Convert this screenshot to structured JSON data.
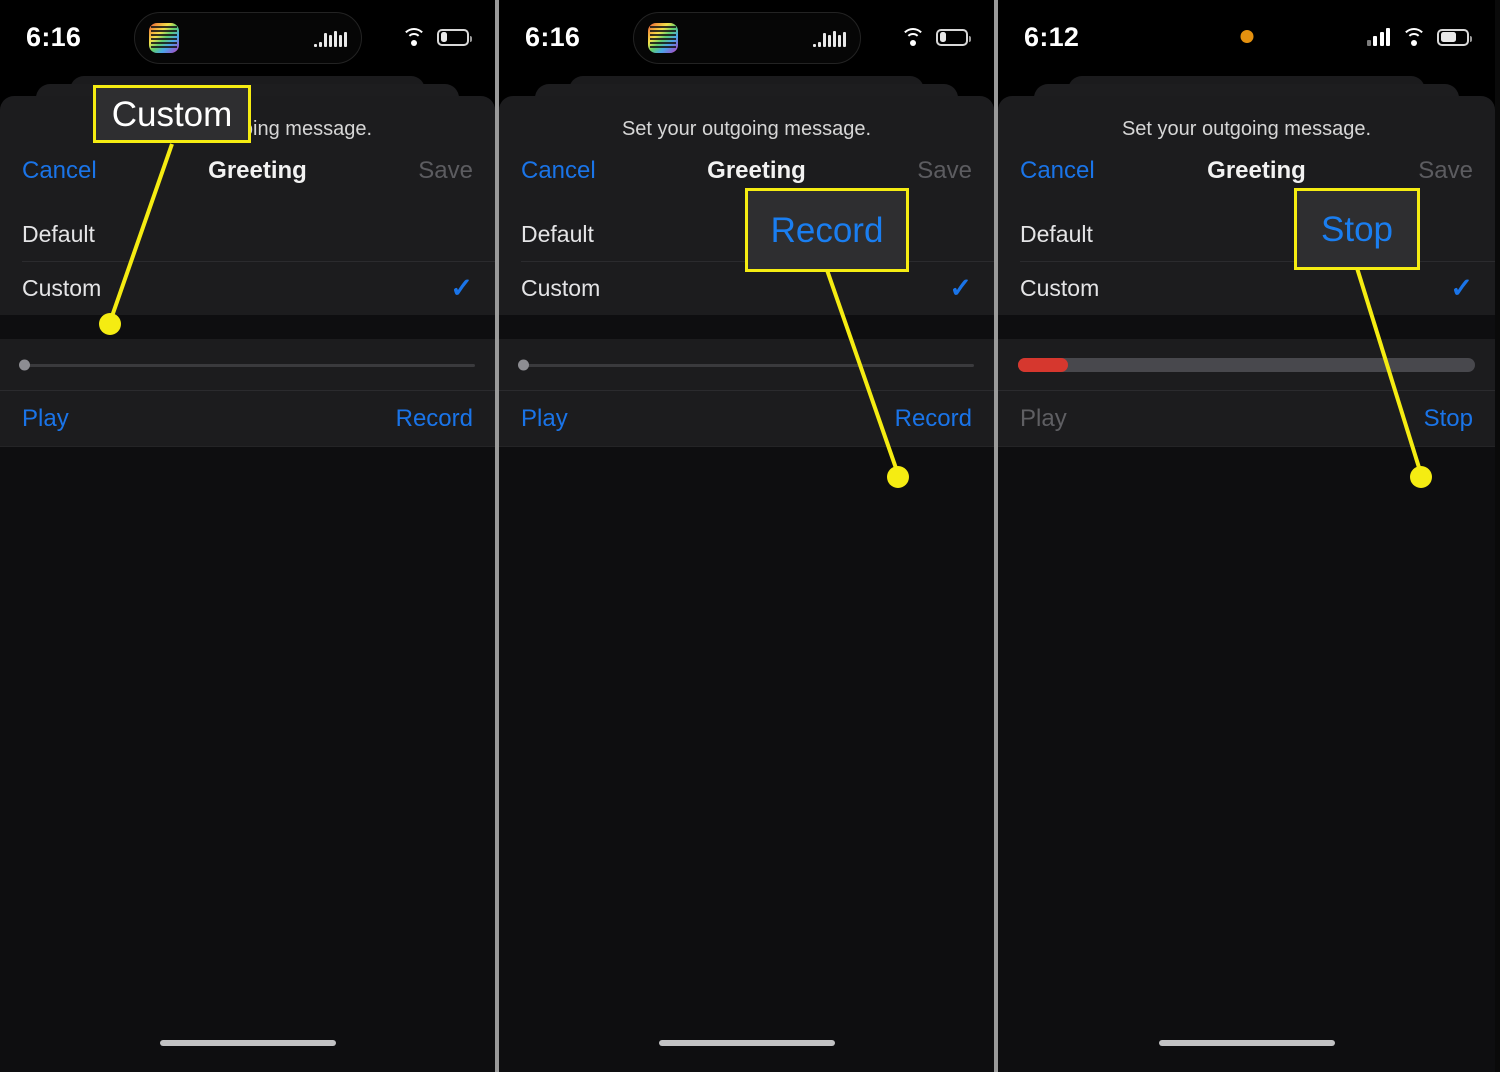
{
  "meta": {
    "accent_blue": "#1a74e8",
    "annotation_yellow": "#f5ec12",
    "record_red": "#d6372e",
    "privacy_orange": "#e5910f",
    "sheet_background": "#1c1c1e"
  },
  "panels": [
    {
      "id": "panel-1",
      "status": {
        "time": "6:16",
        "has_dynamic_island": true,
        "island_icons": [
          "album-art-icon",
          "audio-waveform-icon"
        ],
        "has_privacy_dot": false,
        "has_cellular_signal": false,
        "icons": [
          "wifi-icon",
          "battery-icon"
        ],
        "battery_level_pct": 25
      },
      "sheet": {
        "subtitle": "Set your outgoing message.",
        "cancel_label": "Cancel",
        "title": "Greeting",
        "save_label": "Save",
        "save_enabled": false
      },
      "options": [
        {
          "label": "Default",
          "selected": false
        },
        {
          "label": "Custom",
          "selected": true
        }
      ],
      "slider": {
        "type": "thin",
        "value_pct": 0,
        "recording": false
      },
      "transport": {
        "play_label": "Play",
        "play_enabled": true,
        "action_label": "Record",
        "action_enabled": true
      },
      "annotation": {
        "label": "Custom",
        "style": "white",
        "target": "option-custom"
      }
    },
    {
      "id": "panel-2",
      "status": {
        "time": "6:16",
        "has_dynamic_island": true,
        "island_icons": [
          "album-art-icon",
          "audio-waveform-icon"
        ],
        "has_privacy_dot": false,
        "has_cellular_signal": false,
        "icons": [
          "wifi-icon",
          "battery-icon"
        ],
        "battery_level_pct": 25
      },
      "sheet": {
        "subtitle": "Set your outgoing message.",
        "cancel_label": "Cancel",
        "title": "Greeting",
        "save_label": "Save",
        "save_enabled": false
      },
      "options": [
        {
          "label": "Default",
          "selected": false
        },
        {
          "label": "Custom",
          "selected": true
        }
      ],
      "slider": {
        "type": "thin",
        "value_pct": 0,
        "recording": false
      },
      "transport": {
        "play_label": "Play",
        "play_enabled": true,
        "action_label": "Record",
        "action_enabled": true
      },
      "annotation": {
        "label": "Record",
        "style": "blue",
        "target": "transport-action"
      }
    },
    {
      "id": "panel-3",
      "status": {
        "time": "6:12",
        "has_dynamic_island": false,
        "island_icons": [],
        "has_privacy_dot": true,
        "has_cellular_signal": true,
        "icons": [
          "microphone-privacy-dot-icon",
          "cellular-signal-icon",
          "wifi-icon",
          "battery-icon"
        ],
        "battery_level_pct": 55
      },
      "sheet": {
        "subtitle": "Set your outgoing message.",
        "cancel_label": "Cancel",
        "title": "Greeting",
        "save_label": "Save",
        "save_enabled": false
      },
      "options": [
        {
          "label": "Default",
          "selected": false
        },
        {
          "label": "Custom",
          "selected": true
        }
      ],
      "slider": {
        "type": "thick",
        "value_pct": 11,
        "recording": true
      },
      "transport": {
        "play_label": "Play",
        "play_enabled": false,
        "action_label": "Stop",
        "action_enabled": true
      },
      "annotation": {
        "label": "Stop",
        "style": "blue",
        "target": "transport-action"
      }
    }
  ],
  "symbols": {
    "checkmark": "✓"
  }
}
